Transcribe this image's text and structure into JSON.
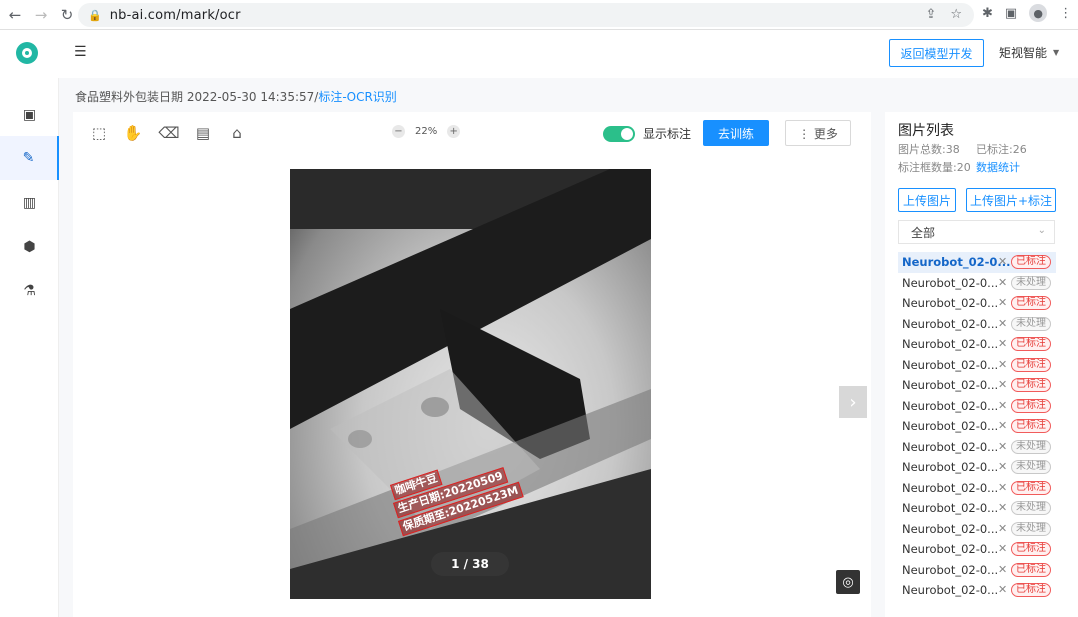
{
  "browser": {
    "url": "nb-ai.com/mark/ocr"
  },
  "header": {
    "back_label": "返回模型开发",
    "user_label": "矩视智能"
  },
  "breadcrumb": {
    "prefix": "食品塑料外包装日期 2022-05-30 14:35:57/",
    "current": "标注-OCR识别"
  },
  "toolbar": {
    "zoom_value": "22%",
    "zoom_minus": "−",
    "zoom_plus": "+",
    "toggle_label": "显示标注",
    "train_label": "去训练",
    "more_label": "⋮ 更多"
  },
  "canvas": {
    "pager": "1 / 38",
    "annotations": [
      "咖啡牛豆",
      "生产日期:20220509",
      "保质期至:20220523M"
    ]
  },
  "panel": {
    "title": "图片列表",
    "total_label": "图片总数:38",
    "labeled_label": "已标注:26",
    "boxes_label": "标注框数量:20",
    "stats_link": "数据统计",
    "upload_label": "上传图片",
    "upload_label2": "上传图片+标注",
    "filter_value": "全部",
    "images": [
      {
        "name": "Neurobot_02-0...",
        "status": "已标注",
        "state": "done"
      },
      {
        "name": "Neurobot_02-0...",
        "status": "未处理",
        "state": "todo"
      },
      {
        "name": "Neurobot_02-0...",
        "status": "已标注",
        "state": "done"
      },
      {
        "name": "Neurobot_02-0...",
        "status": "未处理",
        "state": "todo"
      },
      {
        "name": "Neurobot_02-0...",
        "status": "已标注",
        "state": "done"
      },
      {
        "name": "Neurobot_02-0...",
        "status": "已标注",
        "state": "done"
      },
      {
        "name": "Neurobot_02-0...",
        "status": "已标注",
        "state": "done"
      },
      {
        "name": "Neurobot_02-0...",
        "status": "已标注",
        "state": "done"
      },
      {
        "name": "Neurobot_02-0...",
        "status": "已标注",
        "state": "done"
      },
      {
        "name": "Neurobot_02-0...",
        "status": "未处理",
        "state": "todo"
      },
      {
        "name": "Neurobot_02-0...",
        "status": "未处理",
        "state": "todo"
      },
      {
        "name": "Neurobot_02-0...",
        "status": "已标注",
        "state": "done"
      },
      {
        "name": "Neurobot_02-0...",
        "status": "未处理",
        "state": "todo"
      },
      {
        "name": "Neurobot_02-0...",
        "status": "未处理",
        "state": "todo"
      },
      {
        "name": "Neurobot_02-0...",
        "status": "已标注",
        "state": "done"
      },
      {
        "name": "Neurobot_02-0...",
        "status": "已标注",
        "state": "done"
      },
      {
        "name": "Neurobot_02-0...",
        "status": "已标注",
        "state": "done"
      }
    ]
  },
  "colors": {
    "accent": "#1890ff",
    "brand": "#21b7a4",
    "toggle_on": "#2bbf8a",
    "tag_done": "#e53935"
  }
}
